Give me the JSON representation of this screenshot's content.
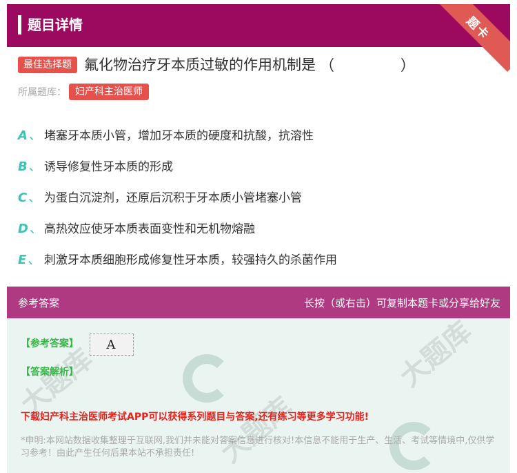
{
  "header": {
    "title": "题目详情",
    "corner_badge": "题卡"
  },
  "question": {
    "type_tag": "最佳选择题",
    "text": "氟化物治疗牙本质过敏的作用机制是",
    "blank": "（　　）",
    "bank_label": "所属题库：",
    "bank_name": "妇产科主治医师"
  },
  "options": [
    {
      "letter": "A",
      "sep": "、",
      "text": "堵塞牙本质小管，增加牙本质的硬度和抗酸，抗溶性"
    },
    {
      "letter": "B",
      "sep": "、",
      "text": "诱导修复性牙本质的形成"
    },
    {
      "letter": "C",
      "sep": "、",
      "text": "为蛋白沉淀剂，还原后沉积于牙本质小管堵塞小管"
    },
    {
      "letter": "D",
      "sep": "、",
      "text": "高热效应使牙本质表面变性和无机物熔融"
    },
    {
      "letter": "E",
      "sep": "、",
      "text": "刺激牙本质细胞形成修复性牙本质，较强持久的杀菌作用"
    }
  ],
  "answer_panel": {
    "title": "参考答案",
    "hint": "长按（或右击）可复制本题卡或分享给好友",
    "answer_label": "【参考答案】",
    "answer_value": "A",
    "explanation_label": "【答案解析】",
    "promo": "下载妇产科主治医师考试APP可以获得系列题目与答案,还有练习等更多学习功能!",
    "disclaimer": "*申明:本网站数据收集整理于互联网,我们并未能对答案信息进行核对!本信息不能用于生产、生活、考试等情境中,仅供学习参考！由此产生任何后果本站不承担责任!"
  },
  "colors": {
    "header_bg": "#9b0a5e",
    "accent_red": "#e6514c",
    "option_letter": "#3cc3b6",
    "answer_head_bg": "#b03a82",
    "answer_body_bg": "#eaf5f2",
    "label_green": "#3cb44b",
    "promo_red": "#e3231c"
  }
}
